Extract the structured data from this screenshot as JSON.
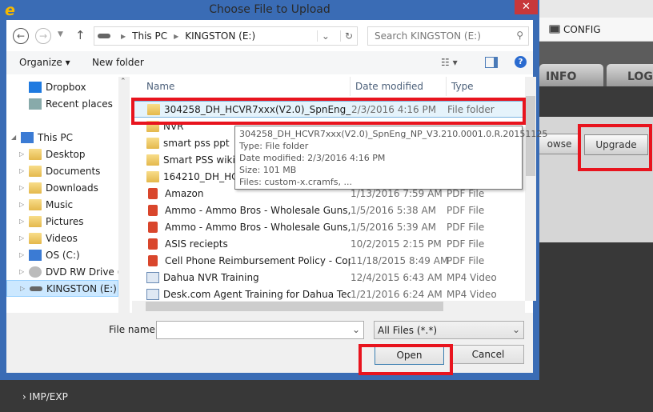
{
  "dialog": {
    "title": "Choose File to Upload",
    "close": "✕"
  },
  "address": {
    "crumbs": [
      "This PC",
      "KINGSTON (E:)"
    ],
    "search_placeholder": "Search KINGSTON (E:)"
  },
  "toolbar": {
    "organize": "Organize ▾",
    "new_folder": "New folder"
  },
  "nav": [
    {
      "label": "Dropbox",
      "icon": "dropbox-icon"
    },
    {
      "label": "Recent places",
      "icon": "recent-places-icon"
    },
    {
      "label": "This PC",
      "icon": "computer-icon"
    },
    {
      "label": "Desktop",
      "icon": "folder-icon"
    },
    {
      "label": "Documents",
      "icon": "folder-icon"
    },
    {
      "label": "Downloads",
      "icon": "folder-icon"
    },
    {
      "label": "Music",
      "icon": "folder-icon"
    },
    {
      "label": "Pictures",
      "icon": "folder-icon"
    },
    {
      "label": "Videos",
      "icon": "folder-icon"
    },
    {
      "label": "OS (C:)",
      "icon": "drive-icon"
    },
    {
      "label": "DVD RW Drive (D",
      "icon": "dvd-icon"
    },
    {
      "label": "KINGSTON (E:)",
      "icon": "usb-drive-icon",
      "selected": true
    }
  ],
  "columns": {
    "name": "Name",
    "date": "Date modified",
    "type": "Type"
  },
  "files": [
    {
      "name": "304258_DH_HCVR7xxx(V2.0)_SpnEng_NP_...",
      "date": "2/3/2016 4:16 PM",
      "type": "File folder",
      "kind": "folder",
      "selected": true
    },
    {
      "name": "NVR",
      "date": "",
      "type": "",
      "kind": "folder"
    },
    {
      "name": "smart pss ppt",
      "date": "",
      "type": "",
      "kind": "folder"
    },
    {
      "name": "Smart PSS wiki pi",
      "date": "",
      "type": "",
      "kind": "folder"
    },
    {
      "name": "164210_DH_HCVI",
      "date": "",
      "type": "",
      "kind": "zip"
    },
    {
      "name": "Amazon",
      "date": "1/13/2016 7:59 AM",
      "type": "PDF File",
      "kind": "pdf"
    },
    {
      "name": "Ammo  - Ammo Bros - Wholesale Guns, ...",
      "date": "1/5/2016 5:38 AM",
      "type": "PDF File",
      "kind": "pdf"
    },
    {
      "name": "Ammo  - Ammo Bros - Wholesale Guns, ...",
      "date": "1/5/2016 5:39 AM",
      "type": "PDF File",
      "kind": "pdf"
    },
    {
      "name": "ASIS reciepts",
      "date": "10/2/2015 2:15 PM",
      "type": "PDF File",
      "kind": "pdf"
    },
    {
      "name": "Cell Phone Reimbursement Policy - Copy",
      "date": "11/18/2015 8:49 AM",
      "type": "PDF File",
      "kind": "pdf"
    },
    {
      "name": "Dahua NVR Training",
      "date": "12/4/2015 6:43 AM",
      "type": "MP4 Video",
      "kind": "video"
    },
    {
      "name": "Desk.com Agent Training for Dahua Tec...",
      "date": "1/21/2016 6:24 AM",
      "type": "MP4 Video",
      "kind": "video"
    }
  ],
  "tooltip": [
    "304258_DH_HCVR7xxx(V2.0)_SpnEng_NP_V3.210.0001.0.R.20151125",
    "Type: File folder",
    "Date modified: 2/3/2016 4:16 PM",
    "Size: 101 MB",
    "Files: custom-x.cramfs, ..."
  ],
  "footer": {
    "file_name_label": "File name:",
    "file_name_value": "",
    "filter": "All Files (*.*)",
    "open": "Open",
    "cancel": "Cancel"
  },
  "background_app": {
    "config": "CONFIG",
    "tabs": [
      "INFO",
      "LOG"
    ],
    "browse": "owse",
    "upgrade": "Upgrade",
    "menu_item": "IMP/EXP"
  },
  "colors": {
    "highlight": "#e8141e",
    "dialog_border": "#3a6cb5"
  }
}
